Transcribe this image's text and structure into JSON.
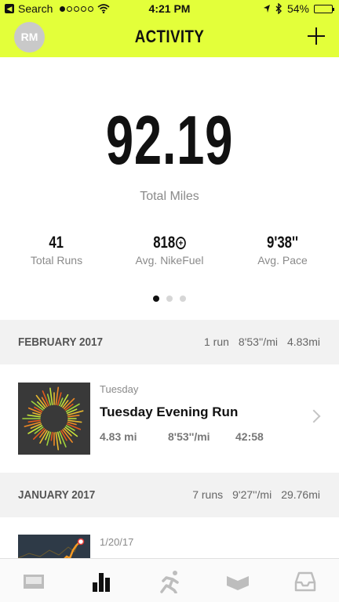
{
  "status_bar": {
    "back_label": "Search",
    "time": "4:21 PM",
    "battery": "54%",
    "battery_level": 0.54,
    "signal_bars_filled": 1,
    "signal_bars_total": 5
  },
  "header": {
    "avatar_initials": "RM",
    "title": "ACTIVITY"
  },
  "summary": {
    "total_miles": "92.19",
    "total_miles_label": "Total Miles",
    "stats": [
      {
        "value": "41",
        "label": "Total Runs"
      },
      {
        "value": "818",
        "label": "Avg. NikeFuel"
      },
      {
        "value": "9'38''",
        "label": "Avg. Pace"
      }
    ],
    "pager_pages": 3,
    "pager_active": 0
  },
  "sections": [
    {
      "month": "FEBRUARY 2017",
      "runs": "1 run",
      "pace": "8'53''/mi",
      "distance": "4.83mi",
      "run": {
        "day": "Tuesday",
        "name": "Tuesday Evening Run",
        "distance": "4.83 mi",
        "pace": "8'53''/mi",
        "duration": "42:58"
      }
    },
    {
      "month": "JANUARY 2017",
      "runs": "7 runs",
      "pace": "9'27''/mi",
      "distance": "29.76mi",
      "run": {
        "day": "1/20/17"
      }
    }
  ],
  "tabs": [
    {
      "icon": "feed-icon",
      "active": false
    },
    {
      "icon": "activity-bars-icon",
      "active": true
    },
    {
      "icon": "runner-icon",
      "active": false
    },
    {
      "icon": "achievements-icon",
      "active": false
    },
    {
      "icon": "inbox-icon",
      "active": false
    }
  ],
  "colors": {
    "accent": "#e3ff3a",
    "text": "#111111",
    "muted": "#8a8a8a",
    "section_bg": "#f2f2f2"
  }
}
